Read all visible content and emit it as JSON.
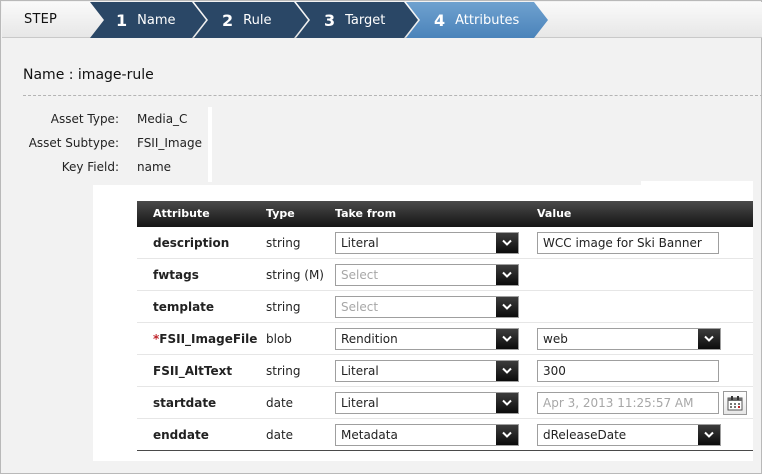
{
  "steps": {
    "label": "STEP",
    "items": [
      {
        "num": "1",
        "label": "Name"
      },
      {
        "num": "2",
        "label": "Rule"
      },
      {
        "num": "3",
        "label": "Target"
      },
      {
        "num": "4",
        "label": "Attributes"
      }
    ],
    "active_color": "#5a92c6",
    "inactive_color": "#2a4766"
  },
  "header": {
    "title": "Name : image-rule"
  },
  "info": [
    {
      "key": "Asset Type:",
      "value": "Media_C"
    },
    {
      "key": "Asset Subtype:",
      "value": "FSII_Image"
    },
    {
      "key": "Key Field:",
      "value": "name"
    }
  ],
  "table": {
    "columns": [
      "Attribute",
      "Type",
      "Take from",
      "Value"
    ],
    "required_marker": "*",
    "rows": [
      {
        "attribute": "description",
        "type": "string",
        "take_from": "Literal",
        "value": "WCC image for Ski Banner"
      },
      {
        "attribute": "fwtags",
        "type": "string (M)",
        "take_from": "Select",
        "value": ""
      },
      {
        "attribute": "template",
        "type": "string",
        "take_from": "Select",
        "value": ""
      },
      {
        "attribute": "FSII_ImageFile",
        "type": "blob",
        "take_from": "Rendition",
        "value": "web"
      },
      {
        "attribute": "FSII_AltText",
        "type": "string",
        "take_from": "Literal",
        "value": "300"
      },
      {
        "attribute": "startdate",
        "type": "date",
        "take_from": "Literal",
        "value": "Apr 3, 2013 11:25:57 AM"
      },
      {
        "attribute": "enddate",
        "type": "date",
        "take_from": "Metadata",
        "value": "dReleaseDate"
      }
    ]
  },
  "icons": {
    "dropdown": "chevron-down-icon",
    "calendar": "calendar-icon"
  }
}
